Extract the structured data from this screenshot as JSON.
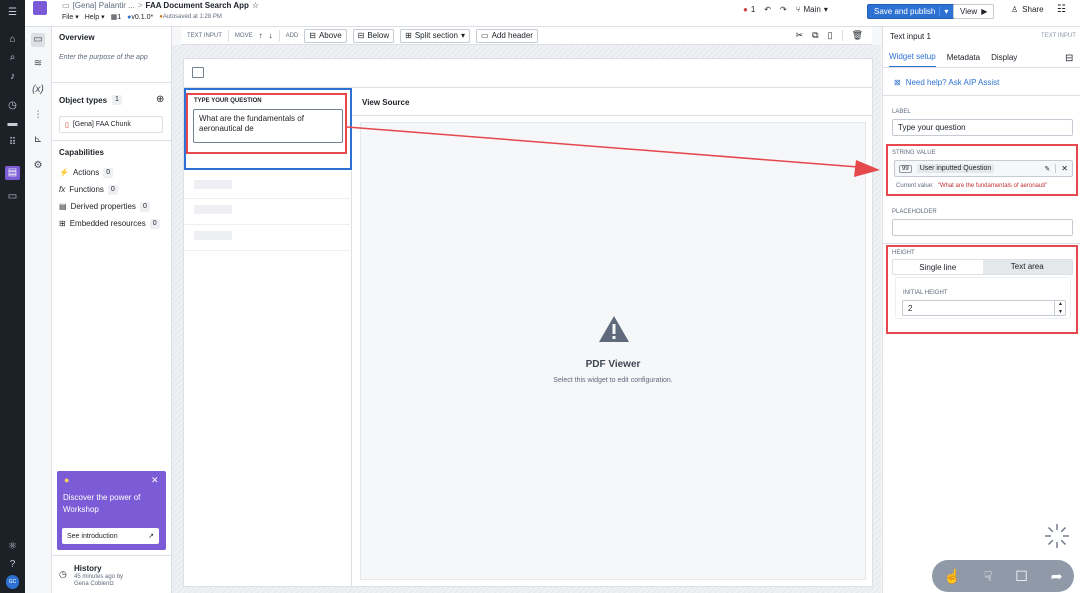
{
  "breadcrumb": {
    "parent": "[Gena] Palantir ...",
    "sep": ">",
    "title": "FAA Document Search App",
    "star": "☆"
  },
  "menus": {
    "file": "File",
    "help": "Help",
    "pages_count": "1",
    "version": "v0.1.0*",
    "autosave": "Autosaved at 1:28 PM"
  },
  "topbar_right": {
    "errors": "1",
    "branch": "Main",
    "save_publish": "Save and publish",
    "view": "View",
    "share": "Share"
  },
  "left_panel": {
    "overview_title": "Overview",
    "purpose_placeholder": "Enter the purpose of the app",
    "object_types_title": "Object types",
    "object_types_count": "1",
    "object_type_item": "[Gena] FAA Chunk",
    "capabilities_title": "Capabilities",
    "capabilities": [
      {
        "label": "Actions",
        "count": "0",
        "icon": "actions-icon"
      },
      {
        "label": "Functions",
        "count": "0",
        "icon": "function-icon"
      },
      {
        "label": "Derived properties",
        "count": "0",
        "icon": "derived-icon"
      },
      {
        "label": "Embedded resources",
        "count": "0",
        "icon": "embed-icon"
      }
    ],
    "promo_title": "Discover the power of Workshop",
    "promo_button": "See introduction",
    "history_title": "History",
    "history_time": "45 minutes ago by",
    "history_user": "Gena Coblentz"
  },
  "rail_badge": "GC",
  "toolbar": {
    "text_input": "TEXT INPUT",
    "move": "MOVE",
    "add": "ADD",
    "above": "Above",
    "below": "Below",
    "split_section": "Split section",
    "add_header": "Add header"
  },
  "canvas": {
    "question_label": "TYPE YOUR QUESTION",
    "question_value": "What are the fundamentals of aeronautical de",
    "view_source_title": "View Source",
    "pdf_title": "PDF Viewer",
    "pdf_subtitle": "Select this widget to edit configuration."
  },
  "right_panel": {
    "widget_name": "Text input 1",
    "widget_type": "TEXT INPUT",
    "tabs": [
      "Widget setup",
      "Metadata",
      "Display"
    ],
    "help_link": "Need help? Ask AIP Assist",
    "label_title": "LABEL",
    "label_value": "Type your question",
    "string_value_title": "STRING VALUE",
    "string_value_chip": "User inputted Question",
    "current_value_label": "Current value:",
    "current_value": "\"What are the fundamentals of aeronauti\"",
    "placeholder_title": "PLACEHOLDER",
    "placeholder_value": "",
    "height_title": "HEIGHT",
    "height_single": "Single line",
    "height_text_area": "Text area",
    "initial_height_title": "INITIAL HEIGHT",
    "initial_height_value": "2"
  },
  "colors": {
    "accent": "#2d72d2",
    "annotation_red": "#e5484d",
    "promo": "#7b5bd6",
    "rail": "#1c2127"
  }
}
